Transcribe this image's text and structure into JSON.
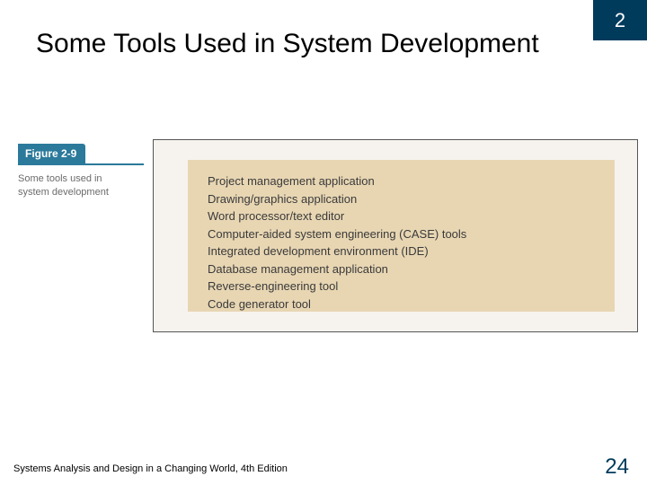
{
  "chapter_number": "2",
  "slide_title": "Some Tools Used in System Development",
  "figure": {
    "label": "Figure 2-9",
    "caption": "Some tools used in system development",
    "tools": [
      "Project management application",
      "Drawing/graphics application",
      "Word processor/text editor",
      "Computer-aided system engineering (CASE) tools",
      "Integrated development environment (IDE)",
      "Database management application",
      "Reverse-engineering tool",
      "Code generator tool"
    ]
  },
  "footer": {
    "left": "Systems Analysis and Design in a Changing World, 4th Edition",
    "page": "24"
  }
}
